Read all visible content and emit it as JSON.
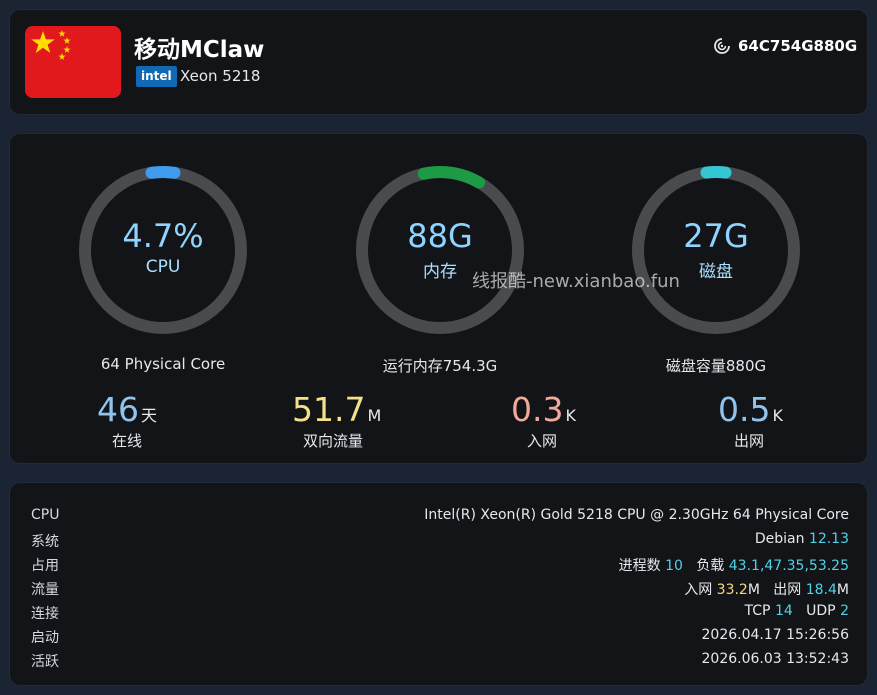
{
  "header": {
    "title": "移动MClaw",
    "cpu_brand": "intel",
    "cpu_model": "Xeon 5218",
    "server_id": "64C754G880G"
  },
  "gauges": [
    {
      "value": "4.7%",
      "label": "CPU",
      "sub": "64 Physical Core",
      "percent": 4.7,
      "color": "#3d9cf0"
    },
    {
      "value": "88G",
      "label": "内存",
      "sub": "运行内存754.3G",
      "percent": 11.7,
      "color": "#1c9a45"
    },
    {
      "value": "27G",
      "label": "磁盘",
      "sub": "磁盘容量880G",
      "percent": 3.1,
      "color": "#34c6d3"
    }
  ],
  "watermark": "线报酷-new.xianbao.fun",
  "stats": [
    {
      "value": "46",
      "unit": "天",
      "caption": "在线",
      "color": "#8fc4ef"
    },
    {
      "value": "51.7",
      "unit": "M",
      "caption": "双向流量",
      "color": "#f5e08a"
    },
    {
      "value": "0.3",
      "unit": "K",
      "caption": "入网",
      "color": "#f2a99a"
    },
    {
      "value": "0.5",
      "unit": "K",
      "caption": "出网",
      "color": "#8fc4ef"
    }
  ],
  "info": {
    "cpu": {
      "key": "CPU",
      "value": "Intel(R) Xeon(R) Gold 5218 CPU @ 2.30GHz 64 Physical Core"
    },
    "system": {
      "key": "系统",
      "name": "Debian",
      "version": "12.13"
    },
    "usage": {
      "key": "占用",
      "proc_label": "进程数",
      "proc": "10",
      "load_label": "负载",
      "load": "43.1,47.35,53.25"
    },
    "traffic": {
      "key": "流量",
      "in_label": "入网",
      "in_value": "33.2",
      "in_unit": "M",
      "out_label": "出网",
      "out_value": "18.4",
      "out_unit": "M"
    },
    "conn": {
      "key": "连接",
      "tcp_label": "TCP",
      "tcp": "14",
      "udp_label": "UDP",
      "udp": "2"
    },
    "boot": {
      "key": "启动",
      "value": "2026.04.17 15:26:56"
    },
    "active": {
      "key": "活跃",
      "value": "2026.06.03 13:52:43"
    }
  }
}
